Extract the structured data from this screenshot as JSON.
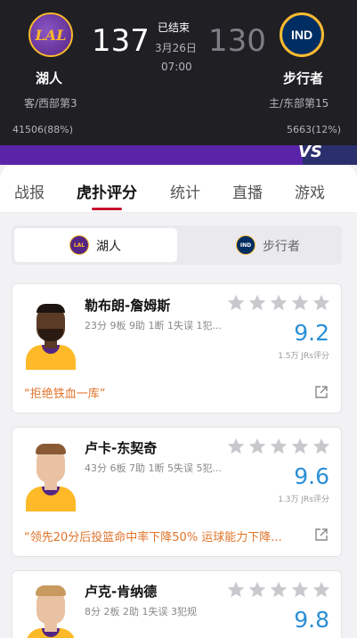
{
  "game": {
    "home": {
      "name": "湖人",
      "logo_text": "LAL",
      "rank": "客/西部第3",
      "score": "137",
      "support": "41506(88%)"
    },
    "away": {
      "name": "步行者",
      "logo_text": "IND",
      "rank": "主/东部第15",
      "score": "130",
      "support": "5663(12%)"
    },
    "status": "已结束",
    "date": "3月26日",
    "time": "07:00",
    "vs_label": "VS",
    "colors": {
      "home_bar": "#5a24a8",
      "away_bar": "#2b2f6d",
      "accent": "#c8102e",
      "rating": "#2a8fd6"
    }
  },
  "tabs": [
    {
      "label": "战报"
    },
    {
      "label": "虎扑评分",
      "active": true
    },
    {
      "label": "统计"
    },
    {
      "label": "直播"
    },
    {
      "label": "游戏"
    }
  ],
  "team_switch": [
    {
      "label": "湖人",
      "logo_text": "LAL",
      "active": true
    },
    {
      "label": "步行者",
      "logo_text": "IND",
      "active": false
    }
  ],
  "players": [
    {
      "name": "勒布朗-詹姆斯",
      "stats": "23分 9板 9助 1断 1失误 1犯...",
      "rating": "9.2",
      "votes": "1.5万 JRs评分",
      "comment": "“拒绝铁血一库”",
      "stars_filled": 0,
      "icons": [
        "star-icon",
        "share-icon"
      ]
    },
    {
      "name": "卢卡-东契奇",
      "stats": "43分 6板 7助 1断 5失误 5犯...",
      "rating": "9.6",
      "votes": "1.3万 JRs评分",
      "comment": "“领先20分后投篮命中率下降50% 运球能力下降...",
      "stars_filled": 0,
      "icons": [
        "star-icon",
        "share-icon"
      ]
    },
    {
      "name": "卢克-肯纳德",
      "stats": "8分 2板 2助 1失误 3犯规",
      "rating": "9.8",
      "votes": "",
      "comment": "",
      "stars_filled": 0,
      "icons": [
        "star-icon"
      ]
    }
  ]
}
